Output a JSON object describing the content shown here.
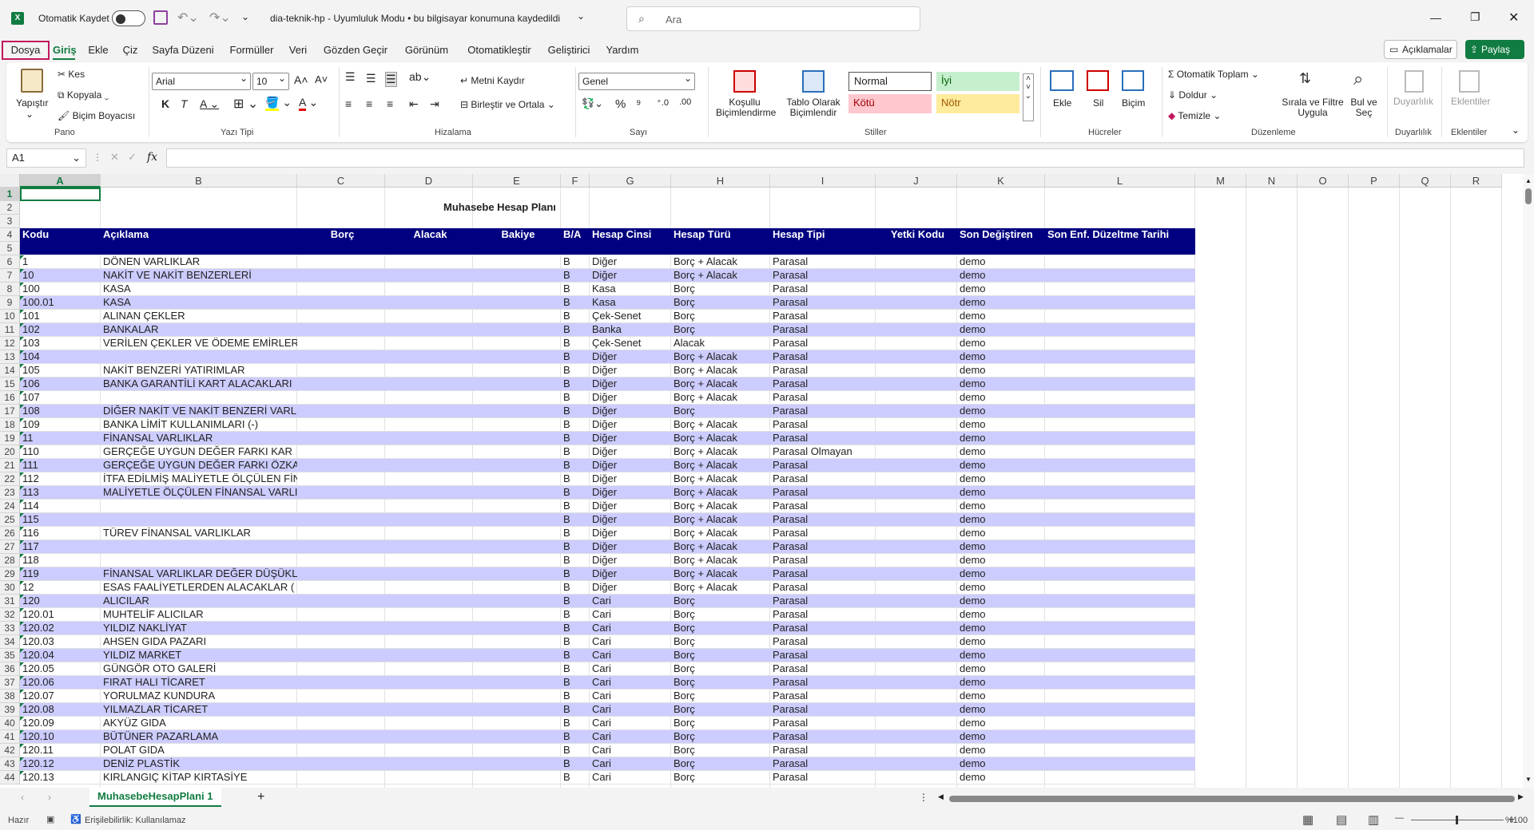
{
  "titlebar": {
    "autosave_label": "Otomatik Kaydet",
    "file_title": "dia-teknik-hp  -  Uyumluluk Modu  •  bu bilgisayar konumuna kaydedildi",
    "search_placeholder": "Ara",
    "excel_logo": "X"
  },
  "menu": {
    "tabs": [
      "Dosya",
      "Giriş",
      "Ekle",
      "Çiz",
      "Sayfa Düzeni",
      "Formüller",
      "Veri",
      "Gözden Geçir",
      "Görünüm",
      "Otomatikleştir",
      "Geliştirici",
      "Yardım"
    ],
    "comments_label": "Açıklamalar",
    "share_label": "Paylaş"
  },
  "ribbon": {
    "clipboard": {
      "paste": "Yapıştır",
      "cut": "Kes",
      "copy": "Kopyala",
      "format_painter": "Biçim Boyacısı",
      "label": "Pano"
    },
    "font": {
      "name": "Arial",
      "size": "10",
      "label": "Yazı Tipi"
    },
    "alignment": {
      "wrap": "Metni Kaydır",
      "merge": "Birleştir ve Ortala",
      "label": "Hizalama"
    },
    "number": {
      "format": "Genel",
      "label": "Sayı"
    },
    "styles": {
      "conditional": "Koşullu Biçimlendirme",
      "table": "Tablo Olarak Biçimlendir",
      "normal": "Normal",
      "good": "İyi",
      "bad": "Kötü",
      "neutral": "Nötr",
      "label": "Stiller"
    },
    "cells": {
      "insert": "Ekle",
      "delete": "Sil",
      "format": "Biçim",
      "label": "Hücreler"
    },
    "editing": {
      "autosum": "Otomatik Toplam",
      "fill": "Doldur",
      "clear": "Temizle",
      "sort": "Sırala ve Filtre Uygula",
      "find": "Bul ve Seç",
      "label": "Düzenleme"
    },
    "sensitivity": {
      "btn": "Duyarlılık",
      "label": "Duyarlılık"
    },
    "addins": {
      "btn": "Eklentiler",
      "label": "Eklentiler"
    }
  },
  "formula_bar": {
    "name_box": "A1",
    "fx": "fx",
    "value": ""
  },
  "columns": [
    "A",
    "B",
    "C",
    "D",
    "E",
    "F",
    "G",
    "H",
    "I",
    "J",
    "K",
    "L",
    "M",
    "N",
    "O",
    "P",
    "Q",
    "R"
  ],
  "sheet": {
    "title": "Muhasebe Hesap Planı",
    "headers": [
      "Kodu",
      "Açıklama",
      "Borç",
      "Alacak",
      "Bakiye",
      "B/A",
      "Hesap Cinsi",
      "Hesap Türü",
      "Hesap Tipi",
      "Yetki Kodu",
      "Son Değiştiren",
      "Son Enf. Düzeltme Tarihi"
    ],
    "rows": [
      [
        "1",
        "DÖNEN VARLIKLAR",
        "B",
        "Diğer",
        "Borç + Alacak",
        "Parasal",
        "demo"
      ],
      [
        "10",
        "NAKİT VE NAKİT BENZERLERİ",
        "B",
        "Diğer",
        "Borç + Alacak",
        "Parasal",
        "demo"
      ],
      [
        "100",
        "KASA",
        "B",
        "Kasa",
        "Borç",
        "Parasal",
        "demo"
      ],
      [
        "100.01",
        "KASA",
        "B",
        "Kasa",
        "Borç",
        "Parasal",
        "demo"
      ],
      [
        "101",
        "ALINAN ÇEKLER",
        "B",
        "Çek-Senet",
        "Borç",
        "Parasal",
        "demo"
      ],
      [
        "102",
        "BANKALAR",
        "B",
        "Banka",
        "Borç",
        "Parasal",
        "demo"
      ],
      [
        "103",
        "VERİLEN ÇEKLER VE ÖDEME EMİRLER",
        "B",
        "Çek-Senet",
        "Alacak",
        "Parasal",
        "demo"
      ],
      [
        "104",
        "",
        "B",
        "Diğer",
        "Borç + Alacak",
        "Parasal",
        "demo"
      ],
      [
        "105",
        "NAKİT BENZERİ YATIRIMLAR",
        "B",
        "Diğer",
        "Borç + Alacak",
        "Parasal",
        "demo"
      ],
      [
        "106",
        "BANKA GARANTİLİ KART ALACAKLARI",
        "B",
        "Diğer",
        "Borç + Alacak",
        "Parasal",
        "demo"
      ],
      [
        "107",
        "",
        "B",
        "Diğer",
        "Borç + Alacak",
        "Parasal",
        "demo"
      ],
      [
        "108",
        "DİĞER NAKİT VE NAKİT BENZERİ VARLI",
        "B",
        "Diğer",
        "Borç",
        "Parasal",
        "demo"
      ],
      [
        "109",
        "BANKA LİMİT KULLANIMLARI (-)",
        "B",
        "Diğer",
        "Borç + Alacak",
        "Parasal",
        "demo"
      ],
      [
        "11",
        "FİNANSAL VARLIKLAR",
        "B",
        "Diğer",
        "Borç + Alacak",
        "Parasal",
        "demo"
      ],
      [
        "110",
        "GERÇEĞE UYGUN DEĞER FARKI KAR",
        "B",
        "Diğer",
        "Borç + Alacak",
        "Parasal Olmayan",
        "demo"
      ],
      [
        "111",
        "GERÇEĞE UYGUN DEĞER FARKI ÖZKA",
        "B",
        "Diğer",
        "Borç + Alacak",
        "Parasal",
        "demo"
      ],
      [
        "112",
        "İTFA EDİLMİŞ MALİYETLE ÖLÇÜLEN FİN",
        "B",
        "Diğer",
        "Borç + Alacak",
        "Parasal",
        "demo"
      ],
      [
        "113",
        "MALİYETLE ÖLÇÜLEN FİNANSAL VARLI",
        "B",
        "Diğer",
        "Borç + Alacak",
        "Parasal",
        "demo"
      ],
      [
        "114",
        "",
        "B",
        "Diğer",
        "Borç + Alacak",
        "Parasal",
        "demo"
      ],
      [
        "115",
        "",
        "B",
        "Diğer",
        "Borç + Alacak",
        "Parasal",
        "demo"
      ],
      [
        "116",
        "TÜREV FİNANSAL VARLIKLAR",
        "B",
        "Diğer",
        "Borç + Alacak",
        "Parasal",
        "demo"
      ],
      [
        "117",
        "",
        "B",
        "Diğer",
        "Borç + Alacak",
        "Parasal",
        "demo"
      ],
      [
        "118",
        "",
        "B",
        "Diğer",
        "Borç + Alacak",
        "Parasal",
        "demo"
      ],
      [
        "119",
        "FİNANSAL VARLIKLAR DEĞER DÜŞÜKL",
        "B",
        "Diğer",
        "Borç + Alacak",
        "Parasal",
        "demo"
      ],
      [
        "12",
        "ESAS FAALİYETLERDEN ALACAKLAR (",
        "B",
        "Diğer",
        "Borç + Alacak",
        "Parasal",
        "demo"
      ],
      [
        "120",
        "ALICILAR",
        "B",
        "Cari",
        "Borç",
        "Parasal",
        "demo"
      ],
      [
        "120.01",
        "MUHTELİF ALICILAR",
        "B",
        "Cari",
        "Borç",
        "Parasal",
        "demo"
      ],
      [
        "120.02",
        "YILDIZ NAKLİYAT",
        "B",
        "Cari",
        "Borç",
        "Parasal",
        "demo"
      ],
      [
        "120.03",
        "AHSEN GIDA PAZARI",
        "B",
        "Cari",
        "Borç",
        "Parasal",
        "demo"
      ],
      [
        "120.04",
        "YILDIZ MARKET",
        "B",
        "Cari",
        "Borç",
        "Parasal",
        "demo"
      ],
      [
        "120.05",
        "GÜNGÖR OTO GALERİ",
        "B",
        "Cari",
        "Borç",
        "Parasal",
        "demo"
      ],
      [
        "120.06",
        "FIRAT HALI TİCARET",
        "B",
        "Cari",
        "Borç",
        "Parasal",
        "demo"
      ],
      [
        "120.07",
        "YORULMAZ KUNDURA",
        "B",
        "Cari",
        "Borç",
        "Parasal",
        "demo"
      ],
      [
        "120.08",
        "YILMAZLAR TİCARET",
        "B",
        "Cari",
        "Borç",
        "Parasal",
        "demo"
      ],
      [
        "120.09",
        "AKYÜZ GIDA",
        "B",
        "Cari",
        "Borç",
        "Parasal",
        "demo"
      ],
      [
        "120.10",
        "BÜTÜNER PAZARLAMA",
        "B",
        "Cari",
        "Borç",
        "Parasal",
        "demo"
      ],
      [
        "120.11",
        "POLAT GIDA",
        "B",
        "Cari",
        "Borç",
        "Parasal",
        "demo"
      ],
      [
        "120.12",
        "DENİZ PLASTİK",
        "B",
        "Cari",
        "Borç",
        "Parasal",
        "demo"
      ],
      [
        "120.13",
        "KIRLANGIÇ KİTAP KIRTASİYE",
        "B",
        "Cari",
        "Borç",
        "Parasal",
        "demo"
      ]
    ]
  },
  "sheet_tab": "MuhasebeHesapPlani 1",
  "status": {
    "ready": "Hazır",
    "accessibility": "Erişilebilirlik: Kullanılamaz",
    "zoom": "%100"
  },
  "colors": {
    "header_fill": "#000080",
    "alt_row": "#ccccff",
    "accent": "#107c41"
  }
}
